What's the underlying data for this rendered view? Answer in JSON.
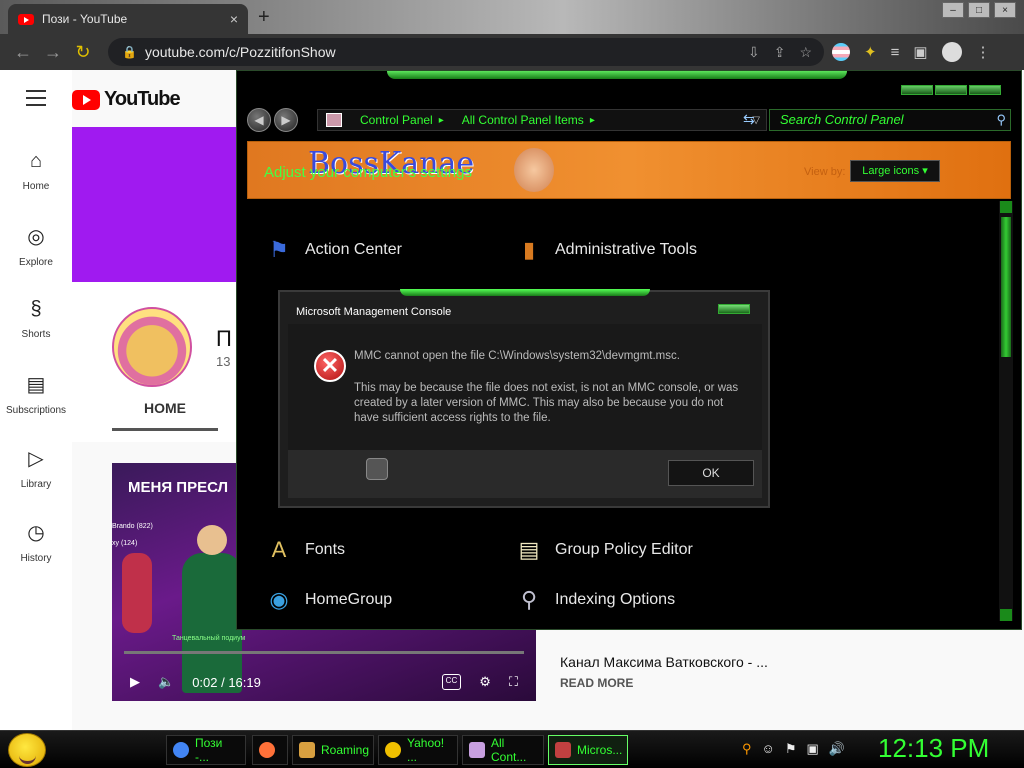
{
  "browser": {
    "tab_title": "Пози - YouTube",
    "tab_close": "×",
    "new_tab": "+",
    "url": "youtube.com/c/PozzitifonShow"
  },
  "youtube": {
    "logo_text": "YouTube",
    "sidebar": [
      {
        "label": "Home",
        "icon": "⌂"
      },
      {
        "label": "Explore",
        "icon": "◎"
      },
      {
        "label": "Shorts",
        "icon": "§"
      },
      {
        "label": "Subscriptions",
        "icon": "▤"
      },
      {
        "label": "Library",
        "icon": "▷"
      },
      {
        "label": "History",
        "icon": "◷"
      }
    ],
    "channel_name": "П",
    "channel_subs": "13",
    "home_tab": "HOME",
    "video": {
      "title": "МЕНЯ ПРЕСЛ",
      "tag1": "Brando (822)",
      "tag2": "xy (124)",
      "floor_label": "Танцевальный подиум",
      "time": "0:02 / 16:19",
      "cc": "CC"
    },
    "description_title": "Канал Максима Ватковского - ...",
    "read_more": "READ MORE"
  },
  "control_panel": {
    "breadcrumb": [
      "Control Panel",
      "All Control Panel Items"
    ],
    "search_placeholder": "Search Control Panel",
    "header_brand": "BossKanae",
    "header_subtitle": "Adjust your computer's settings",
    "view_by_label": "View by:",
    "view_by_value": "Large icons ▾",
    "items": [
      {
        "label": "Action Center",
        "icon": "flag-icon"
      },
      {
        "label": "Administrative Tools",
        "icon": "admin-tools-icon"
      },
      {
        "label": "Fonts",
        "icon": "fonts-icon"
      },
      {
        "label": "Group Policy Editor",
        "icon": "policy-icon"
      },
      {
        "label": "HomeGroup",
        "icon": "homegroup-icon"
      },
      {
        "label": "Indexing Options",
        "icon": "indexing-icon"
      }
    ]
  },
  "mmc_dialog": {
    "title": "Microsoft Management Console",
    "message_primary": "MMC cannot open the file C:\\Windows\\system32\\devmgmt.msc.",
    "message_secondary": "This may be because the file does not exist, is not an MMC console, or was created by a later version of MMC. This may also be because you do not have sufficient access rights to the file.",
    "ok_label": "OK"
  },
  "taskbar": {
    "buttons": [
      {
        "label": "Пози -...",
        "color": "#4285f4"
      },
      {
        "label": "",
        "color": "#ff7139"
      },
      {
        "label": "Roaming",
        "color": "#d8a040"
      },
      {
        "label": "Yahoo! ...",
        "color": "#f0c000"
      },
      {
        "label": "All Cont...",
        "color": "#c8a0e0"
      },
      {
        "label": "Micros...",
        "color": "#c04040"
      }
    ],
    "clock": "12:13 PM"
  }
}
